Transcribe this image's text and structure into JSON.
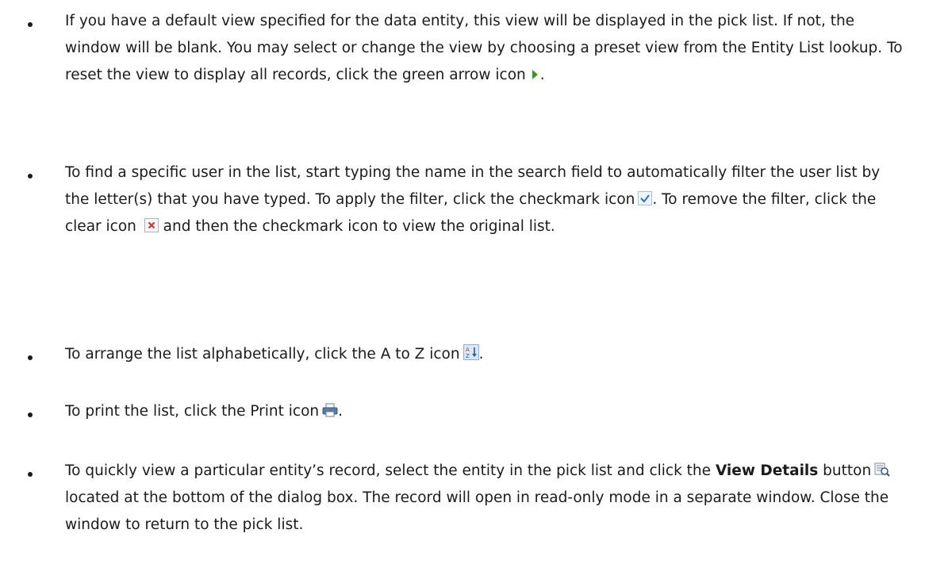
{
  "bullets": [
    {
      "text_before": "If you have a default view specified for the data entity, this view will be displayed in the pick list. If not, the window will be blank. You may select or change the view by choosing a preset view from the Entity List lookup. To reset the view to display all records, click the green arrow icon",
      "icon": "green-arrow-icon",
      "text_after": "."
    },
    {
      "text_1": "To find a specific user in the list, start typing the name in the search field to automatically filter the user list by the letter(s) that you have typed. To apply the filter, click the checkmark icon",
      "icon_1": "checkmark-icon",
      "text_2": ". To remove the filter, click the clear icon",
      "icon_2": "clear-icon",
      "text_3": "and then the checkmark icon to view the original list."
    },
    {
      "text_before": "To arrange the list alphabetically, click the A to Z icon",
      "icon": "a-to-z-sort-icon",
      "text_after": "."
    },
    {
      "text_before": "To print the list, click the Print icon",
      "icon": "print-icon",
      "text_after": "."
    },
    {
      "text_1": "To quickly view a particular entity’s record, select the entity in the pick list and click the",
      "bold": "View Details",
      "text_2": "button",
      "icon": "view-details-icon",
      "text_3": "located at the bottom of the dialog box. The record will open in read-only mode in a separate window. Close the window to return to the pick list."
    }
  ],
  "colors": {
    "text": "#1b1b1b",
    "green_arrow": "#3a9a1e",
    "checkmark": "#2f6fc9",
    "clear": "#d43a2a",
    "print": "#5a7aa8"
  }
}
